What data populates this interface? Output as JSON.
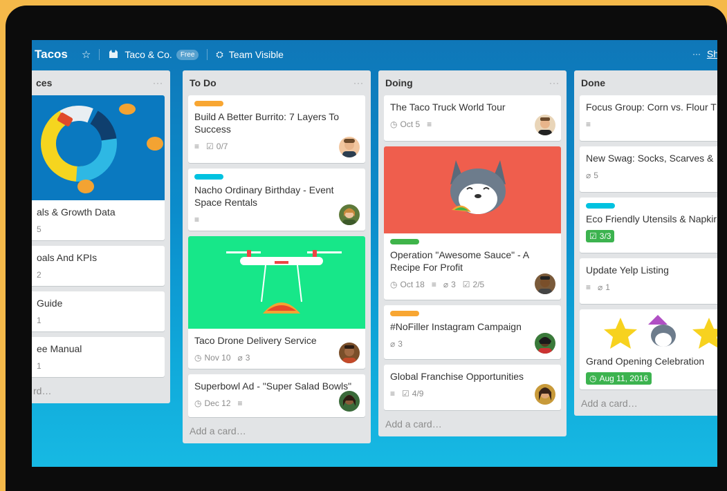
{
  "header": {
    "board_title": "Tacos",
    "team_name": "Taco & Co.",
    "plan_badge": "Free",
    "visibility": "Team Visible",
    "more": "···",
    "show_menu": "Sh"
  },
  "lists": [
    {
      "title": "ces",
      "cards": [
        {
          "title": "als & Growth Data",
          "badge": "5"
        },
        {
          "title": "oals And KPIs",
          "badge": "2"
        },
        {
          "title": "Guide",
          "badge": "1"
        },
        {
          "title": "ee Manual",
          "badge": "1"
        }
      ],
      "add_card": "rd…"
    },
    {
      "title": "To Do",
      "cards": [
        {
          "title": "Build A Better Burrito: 7 Layers To Success",
          "checklist": "0/7"
        },
        {
          "title": "Nacho Ordinary Birthday - Event Space Rentals"
        },
        {
          "title": "Taco Drone Delivery Service",
          "due": "Nov 10",
          "attachments": "3"
        },
        {
          "title": "Superbowl Ad - \"Super Salad Bowls\"",
          "due": "Dec 12"
        }
      ],
      "add_card": "Add a card…"
    },
    {
      "title": "Doing",
      "cards": [
        {
          "title": "The Taco Truck World Tour",
          "due": "Oct 5"
        },
        {
          "title": "Operation \"Awesome Sauce\" - A Recipe For Profit",
          "due": "Oct 18",
          "attachments": "3",
          "checklist": "2/5"
        },
        {
          "title": "#NoFiller Instagram Campaign",
          "attachments": "3"
        },
        {
          "title": "Global Franchise Opportunities",
          "checklist": "4/9"
        }
      ],
      "add_card": "Add a card…"
    },
    {
      "title": "Done",
      "cards": [
        {
          "title": "Focus Group: Corn vs. Flour T"
        },
        {
          "title": "New Swag: Socks, Scarves &",
          "attachments": "5"
        },
        {
          "title": "Eco Friendly Utensils & Napkir",
          "checklist": "3/3"
        },
        {
          "title": "Update Yelp Listing",
          "attachments": "1"
        },
        {
          "title": "Grand Opening Celebration",
          "due": "Aug 11, 2016"
        }
      ],
      "add_card": "Add a card…"
    }
  ],
  "colors": {
    "label_orange": "#f8a632",
    "label_blue": "#00c2e0",
    "label_green": "#61bd4f",
    "board_blue": "#0b8ccb"
  }
}
